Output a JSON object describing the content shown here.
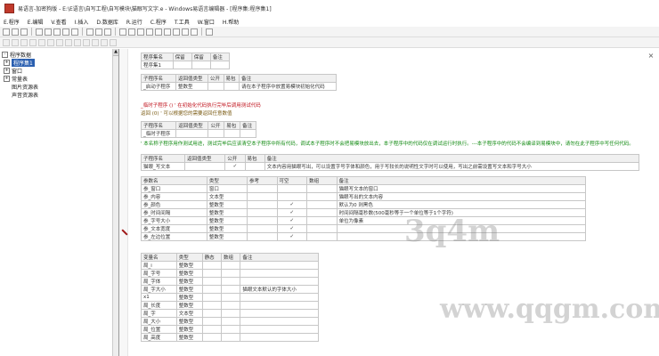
{
  "window": {
    "title": "易语言-加密狗版 - E:\\E语言\\自写工程\\自写模块\\猫眼写文字.e - Windows易语言编辑器 - [程序集:程序集1]"
  },
  "menubar": {
    "items": [
      "E.程序",
      "E.编辑",
      "V.查看",
      "I.插入",
      "D.数据库",
      "R.运行",
      "C.程序",
      "T.工具",
      "W.窗口",
      "H.帮助"
    ]
  },
  "tree": {
    "items": [
      {
        "label": "程序数据",
        "expander": "-"
      },
      {
        "label": "程序集1",
        "expander": "+",
        "selected": true
      },
      {
        "label": "窗口",
        "expander": "+"
      },
      {
        "label": "常量表",
        "expander": "+"
      },
      {
        "label": "图片资源表",
        "expander": ""
      },
      {
        "label": "声音资源表",
        "expander": ""
      }
    ]
  },
  "code": {
    "assembly_header": [
      "程序集名",
      "保留",
      "保留",
      "备注"
    ],
    "assembly_row": [
      "程序集1",
      "",
      "",
      ""
    ],
    "sub1_header": [
      "子程序名",
      "返回值类型",
      "公开",
      "易包",
      "备注"
    ],
    "sub1_row": [
      "_启动子程序",
      "整数型",
      "",
      "",
      "请在本子程序中放置易模块初始化代码"
    ],
    "line_red": "_临时子程序 ()  ' 在初始化代码执行完毕后调用测试代码",
    "line_return": "返回 (0)  ' 可以根据您的需要返回任意数值",
    "sub2_header": [
      "子程序名",
      "返回值类型",
      "公开",
      "易包",
      "备注"
    ],
    "sub2_row": [
      "_临时子程序",
      "",
      "",
      "",
      ""
    ],
    "comment_long": "' 本名称子程序用作测试用途，测试完毕后应该清空本子程序中所有代码，调试本子程序时不会把易模块放出去，本子程序中的代码仅在调试运行时执行。---本子程序中的代码不会编译到易模块中，请勿在此子程序中写任何代码。",
    "sub3_header": [
      "子程序名",
      "返回值类型",
      "公开",
      "易包",
      "备注"
    ],
    "sub3_row": [
      "猫眼_写文本",
      "",
      "✓",
      "",
      "文本内容用猫眼写出，可以设置字号字体和颜色，用于写较长的说明性文字时可以使用，写出之前需设置写文本和字号大小"
    ],
    "param_header": [
      "参数名",
      "类型",
      "参考",
      "可空",
      "数组",
      "备注"
    ],
    "params": [
      {
        "name": "参_窗口",
        "type": "窗口",
        "ref": "",
        "opt": "",
        "arr": "",
        "note": "猫眼写文本的窗口"
      },
      {
        "name": "参_内容",
        "type": "文本型",
        "ref": "",
        "opt": "",
        "arr": "",
        "note": "猫眼写出的文本内容"
      },
      {
        "name": "参_颜色",
        "type": "整数型",
        "ref": "",
        "opt": "✓",
        "arr": "",
        "note": "默认为0 则黑色"
      },
      {
        "name": "参_时间间隔",
        "type": "整数型",
        "ref": "",
        "opt": "✓",
        "arr": "",
        "note": "时间间隔毫秒数(500毫秒等于一个单位等于1个字符)"
      },
      {
        "name": "参_字号大小",
        "type": "整数型",
        "ref": "",
        "opt": "✓",
        "arr": "",
        "note": "单位为像素"
      },
      {
        "name": "参_文本宽度",
        "type": "整数型",
        "ref": "",
        "opt": "✓",
        "arr": "",
        "note": ""
      },
      {
        "name": "参_左边位置",
        "type": "整数型",
        "ref": "",
        "opt": "✓",
        "arr": "",
        "note": ""
      }
    ],
    "var_header": [
      "变量名",
      "类型",
      "静态",
      "数组",
      "备注"
    ],
    "vars": [
      {
        "name": "局_i",
        "type": "整数型",
        "note": ""
      },
      {
        "name": "局_字号",
        "type": "整数型",
        "note": ""
      },
      {
        "name": "局_字体",
        "type": "整数型",
        "note": ""
      },
      {
        "name": "局_字大小",
        "type": "整数型",
        "note": "猫眼文本默认的字体大小"
      },
      {
        "name": "x1",
        "type": "整数型",
        "note": ""
      },
      {
        "name": "局_长度",
        "type": "整数型",
        "note": ""
      },
      {
        "name": "局_字",
        "type": "文本型",
        "note": ""
      },
      {
        "name": "局_大小",
        "type": "整数型",
        "note": ""
      },
      {
        "name": "局_位置",
        "type": "整数型",
        "note": ""
      },
      {
        "name": "局_高度",
        "type": "整数型",
        "note": ""
      }
    ]
  },
  "watermarks": [
    "3q4m",
    "www.qqgm.com"
  ]
}
